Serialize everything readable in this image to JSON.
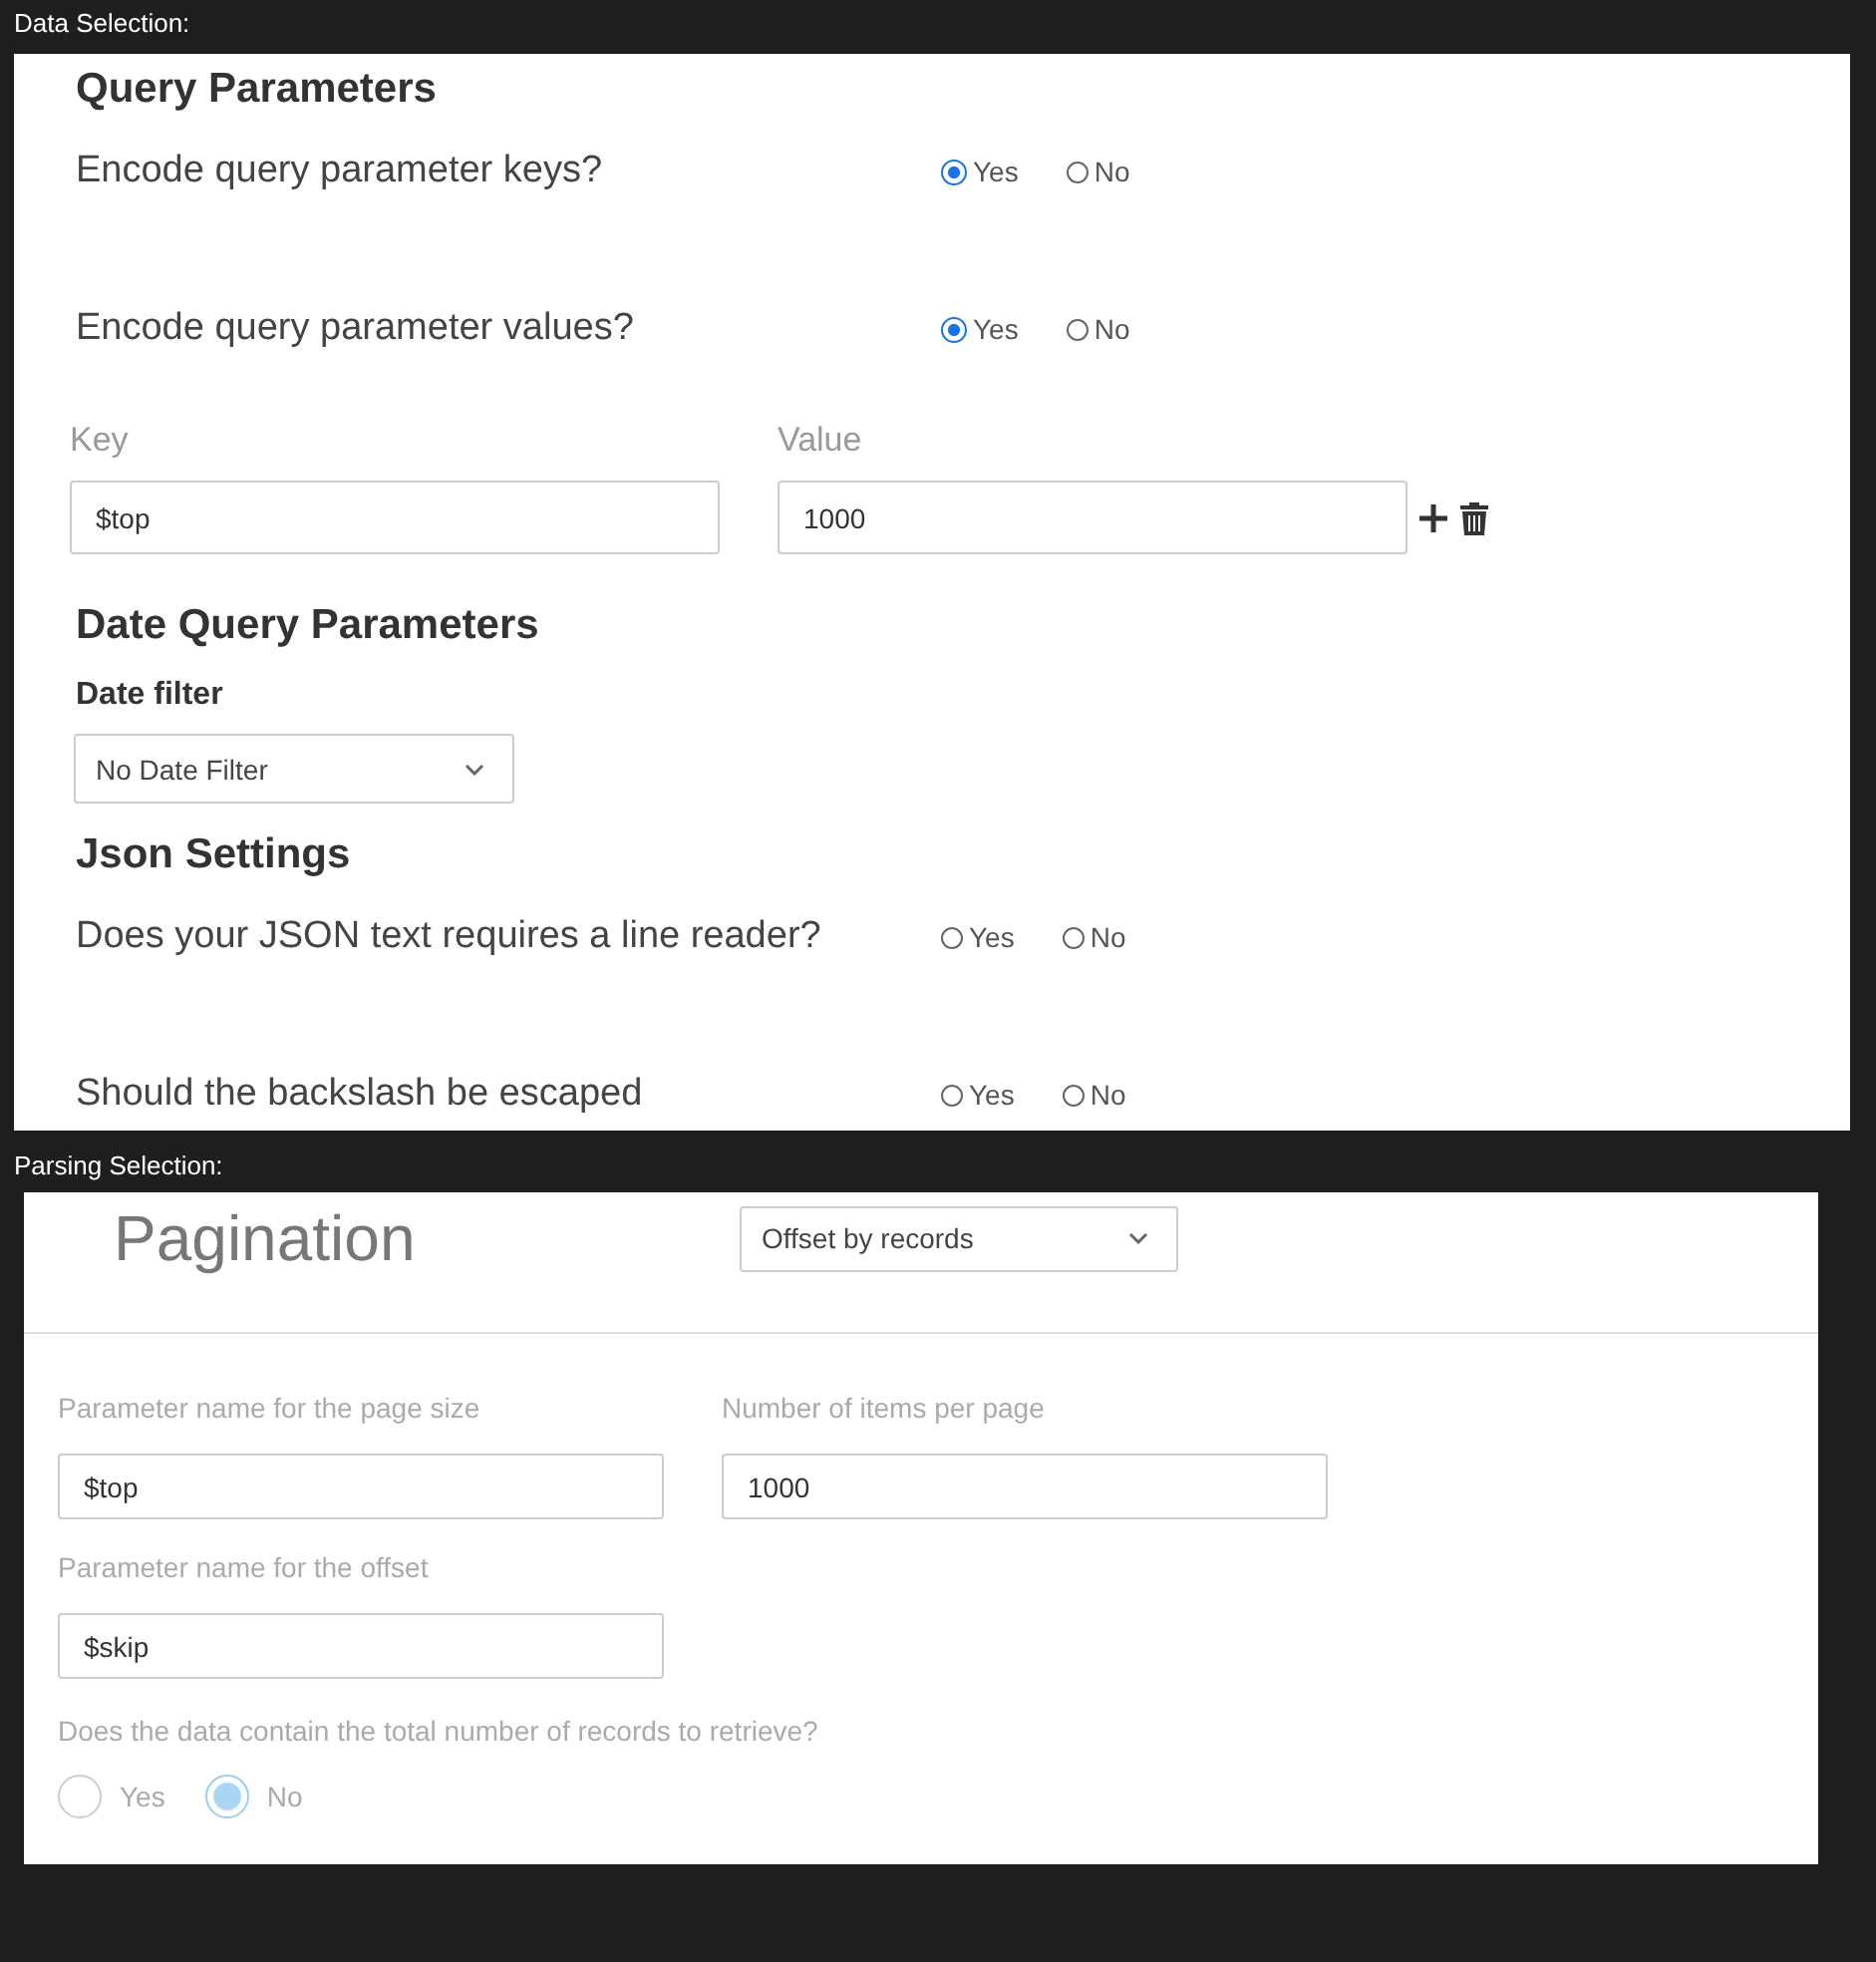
{
  "data_selection": {
    "label": "Data Selection:",
    "query_parameters": {
      "title": "Query Parameters",
      "questions": [
        {
          "text": "Encode query parameter keys?",
          "options": [
            {
              "label": "Yes",
              "selected": true
            },
            {
              "label": "No",
              "selected": false
            }
          ]
        },
        {
          "text": "Encode query parameter values?",
          "options": [
            {
              "label": "Yes",
              "selected": true
            },
            {
              "label": "No",
              "selected": false
            }
          ]
        }
      ],
      "key_header": "Key",
      "value_header": "Value",
      "rows": [
        {
          "key": "$top",
          "value": "1000"
        }
      ]
    },
    "date_query_parameters": {
      "title": "Date Query Parameters",
      "filter_label": "Date filter",
      "filter": "No Date Filter"
    },
    "json_settings": {
      "title": "Json Settings",
      "questions": [
        {
          "text": "Does your JSON text requires a line reader?",
          "options": [
            {
              "label": "Yes",
              "selected": false
            },
            {
              "label": "No",
              "selected": false
            }
          ]
        },
        {
          "text": "Should the backslash be escaped",
          "options": [
            {
              "label": "Yes",
              "selected": false
            },
            {
              "label": "No",
              "selected": false
            }
          ]
        }
      ]
    }
  },
  "parsing_selection": {
    "label": "Parsing Selection:",
    "title": "Pagination",
    "mode": "Offset by records",
    "fields": [
      {
        "label": "Parameter name for the page size",
        "value": "$top"
      },
      {
        "label": "Number of items per page",
        "value": "1000"
      },
      {
        "label": "Parameter name for the offset",
        "value": "$skip"
      }
    ],
    "question": {
      "text": "Does the data contain the total number of records to retrieve?",
      "options": [
        {
          "label": "Yes",
          "selected": false
        },
        {
          "label": "No",
          "selected": true
        }
      ]
    }
  }
}
